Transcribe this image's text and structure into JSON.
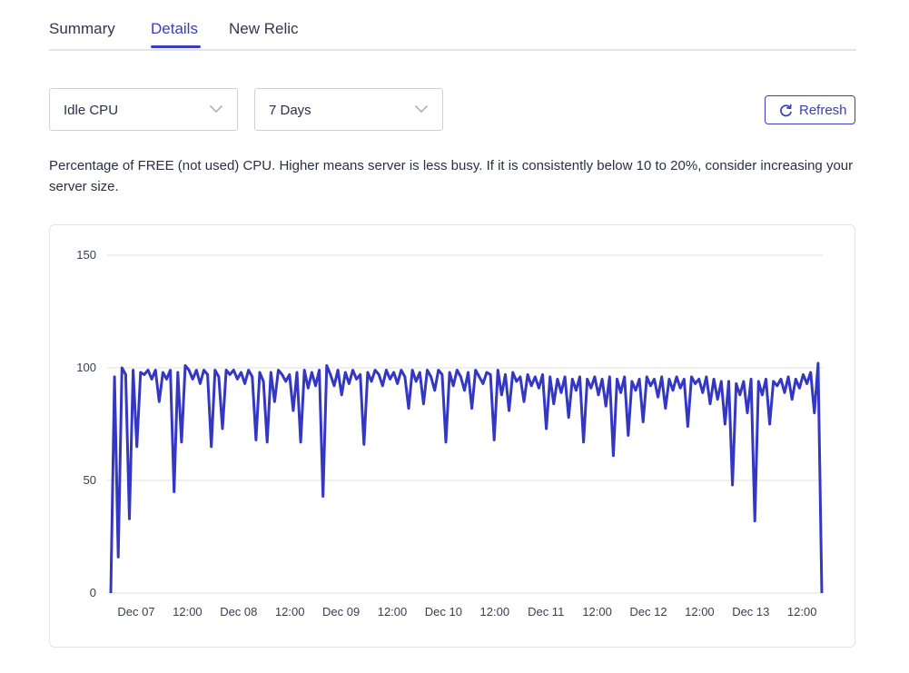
{
  "tabs": [
    {
      "label": "Summary",
      "active": false
    },
    {
      "label": "Details",
      "active": true
    },
    {
      "label": "New Relic",
      "active": false
    }
  ],
  "filters": {
    "metric": {
      "value": "Idle CPU",
      "icon": "chevron-down-icon"
    },
    "range": {
      "value": "7 Days",
      "icon": "chevron-down-icon"
    }
  },
  "refresh": {
    "label": "Refresh",
    "icon": "refresh-icon"
  },
  "description": "Percentage of FREE (not used) CPU. Higher means server is less busy. If it is consistently below 10 to 20%, consider increasing your server size.",
  "colors": {
    "accent": "#3b3fb5",
    "line": "#3337c4",
    "grid": "#e0e1e6"
  },
  "chart_data": {
    "type": "line",
    "y_ticks": [
      0,
      50,
      100,
      150
    ],
    "ylim": [
      0,
      150
    ],
    "x_tick_labels": [
      "Dec 07",
      "12:00",
      "Dec 08",
      "12:00",
      "Dec 09",
      "12:00",
      "Dec 10",
      "12:00",
      "Dec 11",
      "12:00",
      "Dec 12",
      "12:00",
      "Dec 13",
      "12:00"
    ],
    "grid": true,
    "series": [
      {
        "x_start": "Dec 06 21:00",
        "x_end": "Dec 13 21:00",
        "values": [
          0,
          96,
          16,
          100,
          97,
          33,
          99,
          65,
          98,
          97,
          99,
          95,
          99,
          85,
          98,
          95,
          99,
          45,
          98,
          67,
          101,
          99,
          95,
          99,
          93,
          99,
          97,
          65,
          99,
          96,
          73,
          99,
          97,
          99,
          95,
          98,
          93,
          99,
          96,
          68,
          98,
          94,
          67,
          98,
          85,
          99,
          97,
          94,
          97,
          81,
          98,
          67,
          99,
          91,
          98,
          92,
          99,
          43,
          101,
          97,
          92,
          99,
          88,
          98,
          93,
          99,
          95,
          97,
          66,
          98,
          94,
          99,
          97,
          92,
          99,
          95,
          98,
          93,
          99,
          96,
          82,
          99,
          94,
          98,
          84,
          99,
          96,
          90,
          99,
          97,
          67,
          98,
          92,
          99,
          96,
          90,
          98,
          82,
          99,
          96,
          93,
          98,
          97,
          68,
          99,
          88,
          97,
          81,
          98,
          94,
          96,
          85,
          97,
          92,
          96,
          91,
          97,
          73,
          96,
          84,
          95,
          89,
          96,
          78,
          95,
          90,
          96,
          67,
          95,
          91,
          96,
          88,
          95,
          83,
          96,
          61,
          95,
          89,
          96,
          70,
          94,
          90,
          95,
          76,
          96,
          92,
          95,
          87,
          96,
          82,
          95,
          90,
          96,
          91,
          95,
          74,
          96,
          93,
          95,
          89,
          96,
          84,
          95,
          86,
          94,
          75,
          94,
          48,
          93,
          88,
          94,
          80,
          95,
          32,
          94,
          88,
          95,
          75,
          94,
          92,
          95,
          89,
          96,
          86,
          95,
          91,
          97,
          93,
          98,
          80,
          102,
          0
        ]
      }
    ]
  }
}
